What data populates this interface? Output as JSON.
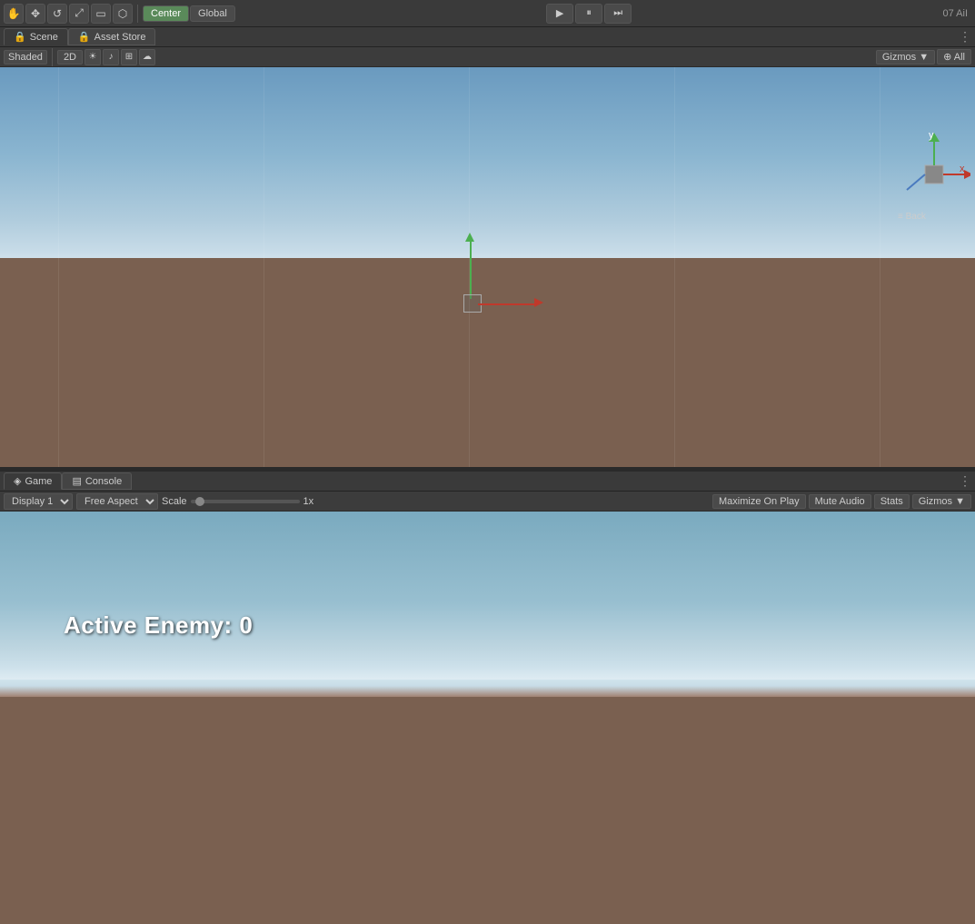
{
  "toolbar": {
    "center_label": "Center",
    "global_label": "Global",
    "play_icon": "▶",
    "pause_icon": "⏸",
    "step_icon": "⏭"
  },
  "scene_tab": {
    "label": "Scene",
    "lock_icon": "🔒"
  },
  "asset_store_tab": {
    "label": "Asset Store",
    "lock_icon": "🔒"
  },
  "scene_toolbar": {
    "shaded_label": "Shaded",
    "twod_label": "2D",
    "gizmos_label": "Gizmos",
    "all_label": "⊕ All"
  },
  "game_tab": {
    "label": "Game",
    "icon": "◈"
  },
  "console_tab": {
    "label": "Console",
    "icon": "▤"
  },
  "game_toolbar": {
    "display_label": "Display 1",
    "aspect_label": "Free Aspect",
    "scale_label": "Scale",
    "scale_value": "1x",
    "maximize_label": "Maximize On Play",
    "mute_label": "Mute Audio",
    "stats_label": "Stats",
    "gizmos_label": "Gizmos"
  },
  "game_viewport": {
    "active_enemy_label": "Active Enemy: 0"
  },
  "orientation_gizmo": {
    "y_label": "y",
    "x_label": "x",
    "back_label": "≡ Back"
  },
  "top_right": {
    "info": "07 AiI"
  }
}
